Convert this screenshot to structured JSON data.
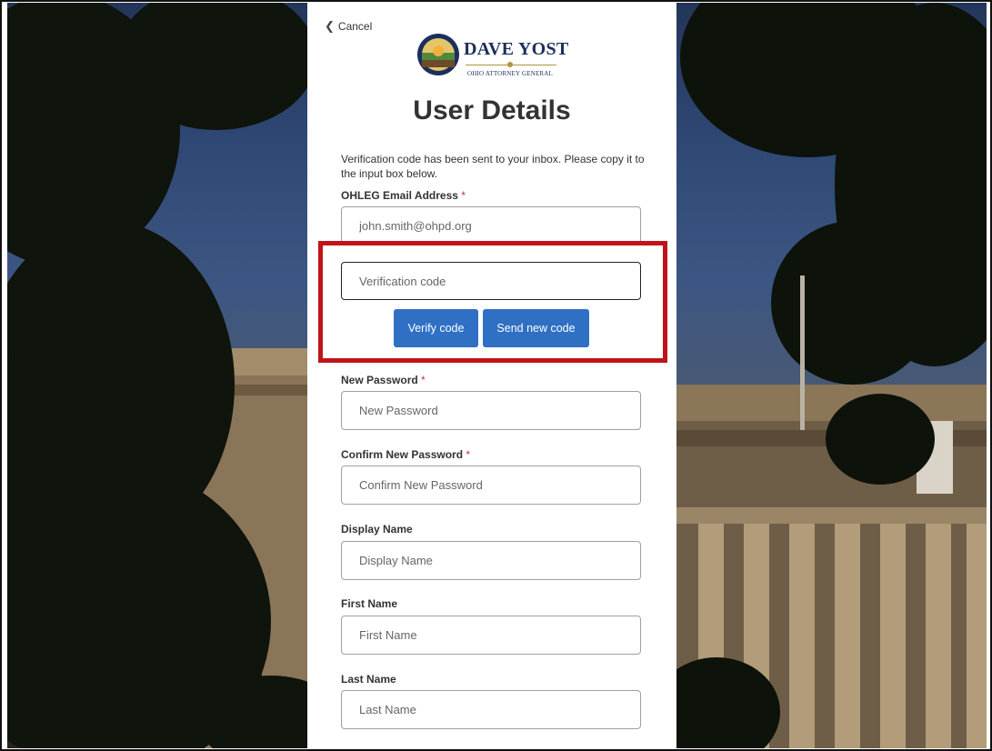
{
  "form": {
    "cancel_label": "Cancel",
    "logo": {
      "name": "DAVE YOST",
      "subtitle": "OHIO ATTORNEY GENERAL"
    },
    "title": "User Details",
    "info_text": "Verification code has been sent to your inbox. Please copy it to the input box below.",
    "required_mark": "*",
    "email": {
      "label": "OHLEG Email Address",
      "value": "john.smith@ohpd.org"
    },
    "verification": {
      "placeholder": "Verification code"
    },
    "verify_button": "Verify code",
    "send_new_button": "Send new code",
    "new_password": {
      "label": "New Password",
      "placeholder": "New Password"
    },
    "confirm_password": {
      "label": "Confirm New Password",
      "placeholder": "Confirm New Password"
    },
    "display_name": {
      "label": "Display Name",
      "placeholder": "Display Name"
    },
    "first_name": {
      "label": "First Name",
      "placeholder": "First Name"
    },
    "last_name": {
      "label": "Last Name",
      "placeholder": "Last Name"
    }
  },
  "colors": {
    "button": "#2f6fc4",
    "required": "#d0312d",
    "highlight": "#c0141b",
    "logo_text": "#1c2f5c"
  }
}
